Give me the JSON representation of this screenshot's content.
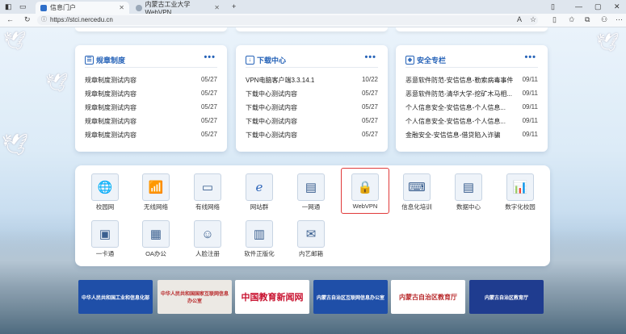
{
  "browser": {
    "tabs": [
      {
        "label": "信息门户",
        "active": true
      },
      {
        "label": "内蒙古工业大学 WebVPN",
        "active": false
      }
    ],
    "url": "https://stci.nercedu.cn"
  },
  "panels": [
    {
      "title": "规章制度",
      "rows": [
        {
          "text": "规章制度测试内容",
          "date": "05/27"
        },
        {
          "text": "规章制度测试内容",
          "date": "05/27"
        },
        {
          "text": "规章制度测试内容",
          "date": "05/27"
        },
        {
          "text": "规章制度测试内容",
          "date": "05/27"
        },
        {
          "text": "规章制度测试内容",
          "date": "05/27"
        }
      ]
    },
    {
      "title": "下载中心",
      "rows": [
        {
          "text": "VPN电脑客户端3.3.14.1",
          "date": "10/22"
        },
        {
          "text": "下载中心测试内容",
          "date": "05/27"
        },
        {
          "text": "下载中心测试内容",
          "date": "05/27"
        },
        {
          "text": "下载中心测试内容",
          "date": "05/27"
        },
        {
          "text": "下载中心测试内容",
          "date": "05/27"
        }
      ]
    },
    {
      "title": "安全专栏",
      "rows": [
        {
          "text": "恶意软件防范-安信信息-勒索病毒事件",
          "date": "09/11"
        },
        {
          "text": "恶意软件防范-清华大学-挖矿木马相...",
          "date": "09/11"
        },
        {
          "text": "个人信息安全-安信信息-个人信息...",
          "date": "09/11"
        },
        {
          "text": "个人信息安全-安信信息-个人信息...",
          "date": "09/11"
        },
        {
          "text": "金融安全-安信信息-借贷陷入诈骗",
          "date": "09/11"
        }
      ]
    }
  ],
  "more_label": "•••",
  "apps": [
    {
      "label": "校园网",
      "icon": "globe-icon",
      "glyph": "🌐"
    },
    {
      "label": "无线网络",
      "icon": "router-icon",
      "glyph": "📶"
    },
    {
      "label": "有线网络",
      "icon": "wired-network-icon",
      "glyph": "🖧"
    },
    {
      "label": "网站群",
      "icon": "browser-icon",
      "glyph": "e"
    },
    {
      "label": "一网通",
      "icon": "open-icon",
      "glyph": "▭"
    },
    {
      "label": "WebVPN",
      "icon": "webvpn-icon",
      "glyph": "🔒"
    },
    {
      "label": "信息化培训",
      "icon": "training-icon",
      "glyph": "👨‍🏫"
    },
    {
      "label": "数据中心",
      "icon": "server-icon",
      "glyph": "▤"
    },
    {
      "label": "数字化校园",
      "icon": "chart-icon",
      "glyph": "📊"
    },
    {
      "label": "一卡通",
      "icon": "card-icon",
      "glyph": "▣"
    },
    {
      "label": "OA办公",
      "icon": "oa-icon",
      "glyph": "▦"
    },
    {
      "label": "人脸注册",
      "icon": "face-icon",
      "glyph": "☺"
    },
    {
      "label": "软件正版化",
      "icon": "software-icon",
      "glyph": "▥"
    },
    {
      "label": "内艺邮箱",
      "icon": "mail-icon",
      "glyph": "✉"
    }
  ],
  "banners": [
    {
      "label": "中华人民共和国工业和信息化部",
      "bg": "#1f4fa8",
      "color": "#ffffff"
    },
    {
      "label": "中华人民共和国国家互联网信息办公室",
      "bg": "#ece9e4",
      "color": "#b8282a"
    },
    {
      "label": "中国教育新闻网",
      "bg": "#ffffff",
      "color": "#c8102e"
    },
    {
      "label": "内蒙古自治区互联网信息办公室",
      "bg": "#1f4fa8",
      "color": "#ffffff"
    },
    {
      "label": "内蒙古自治区教育厅",
      "bg": "#ffffff",
      "color": "#b8282a"
    },
    {
      "label": "内蒙古自治区教育厅",
      "bg": "#1f3c8f",
      "color": "#ffffff"
    }
  ],
  "colors": {
    "accent": "#2663b8",
    "highlight": "#e03a3a"
  }
}
